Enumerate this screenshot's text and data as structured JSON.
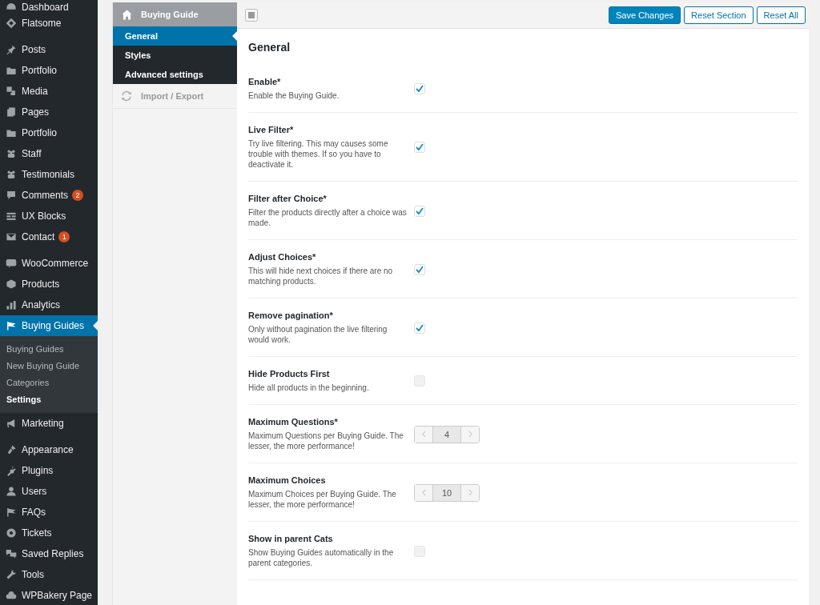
{
  "admin_menu": {
    "groups": [
      [
        {
          "label": "Dashboard",
          "selected": false
        },
        {
          "label": "Flatsome",
          "selected": false
        }
      ],
      [
        {
          "label": "Posts",
          "selected": false
        },
        {
          "label": "Portfolio",
          "selected": false
        },
        {
          "label": "Media",
          "selected": false
        },
        {
          "label": "Pages",
          "selected": false
        },
        {
          "label": "Portfolio",
          "selected": false
        },
        {
          "label": "Staff",
          "selected": false
        },
        {
          "label": "Testimonials",
          "selected": false
        },
        {
          "label": "Comments",
          "badge": "2",
          "selected": false
        },
        {
          "label": "UX Blocks",
          "selected": false
        },
        {
          "label": "Contact",
          "badge": "1",
          "selected": false
        }
      ],
      [
        {
          "label": "WooCommerce",
          "selected": false
        },
        {
          "label": "Products",
          "selected": false
        },
        {
          "label": "Analytics",
          "selected": false
        },
        {
          "label": "Buying Guides",
          "selected": true,
          "children": [
            {
              "label": "Buying Guides",
              "selected": false
            },
            {
              "label": "New Buying Guide",
              "selected": false
            },
            {
              "label": "Categories",
              "selected": false
            },
            {
              "label": "Settings",
              "selected": true
            }
          ]
        },
        {
          "label": "Marketing",
          "selected": false
        }
      ],
      [
        {
          "label": "Appearance",
          "selected": false
        },
        {
          "label": "Plugins",
          "selected": false
        },
        {
          "label": "Users",
          "selected": false
        },
        {
          "label": "FAQs",
          "selected": false
        },
        {
          "label": "Tickets",
          "selected": false
        },
        {
          "label": "Saved Replies",
          "selected": false
        },
        {
          "label": "Tools",
          "selected": false
        },
        {
          "label": "WPBakery Page",
          "selected": false
        }
      ]
    ]
  },
  "options_nav": {
    "title": "Buying Guide",
    "sections": [
      {
        "label": "General",
        "selected": true
      },
      {
        "label": "Styles",
        "selected": false
      },
      {
        "label": "Advanced settings",
        "selected": false
      }
    ],
    "import_export": "Import / Export"
  },
  "toolbar": {
    "buttons": [
      {
        "label": "Save Changes",
        "kind": "primary"
      },
      {
        "label": "Reset Section",
        "kind": "secondary"
      },
      {
        "label": "Reset All",
        "kind": "secondary"
      }
    ]
  },
  "section_title": "General",
  "settings": [
    {
      "kind": "checkbox",
      "label": "Enable*",
      "description": "Enable the Buying Guide.",
      "checked": true
    },
    {
      "kind": "checkbox",
      "label": "Live Filter*",
      "description": "Try live filtering. This may causes some trouble with themes. If so you have to deactivate it.",
      "checked": true
    },
    {
      "kind": "checkbox",
      "label": "Filter after Choice*",
      "description": "Filter the products directly after a choice was made.",
      "checked": true
    },
    {
      "kind": "checkbox",
      "label": "Adjust Choices*",
      "description": "This will hide next choices if there are no matching products.",
      "checked": true
    },
    {
      "kind": "checkbox",
      "label": "Remove pagination*",
      "description": "Only without pagination the live filtering would work.",
      "checked": true
    },
    {
      "kind": "checkbox",
      "label": "Hide Products First",
      "description": "Hide all products in the beginning.",
      "checked": false
    },
    {
      "kind": "stepper",
      "label": "Maximum Questions*",
      "description": "Maximum Questions per Buying Guide. The lesser, the more performance!",
      "value": "4"
    },
    {
      "kind": "stepper",
      "label": "Maximum Choices",
      "description": "Maximum Choices per Buying Guide. The lesser, the more performance!",
      "value": "10"
    },
    {
      "kind": "checkbox",
      "label": "Show in parent Cats",
      "description": "Show Buying Guides automatically in the parent categories.",
      "checked": false
    }
  ]
}
